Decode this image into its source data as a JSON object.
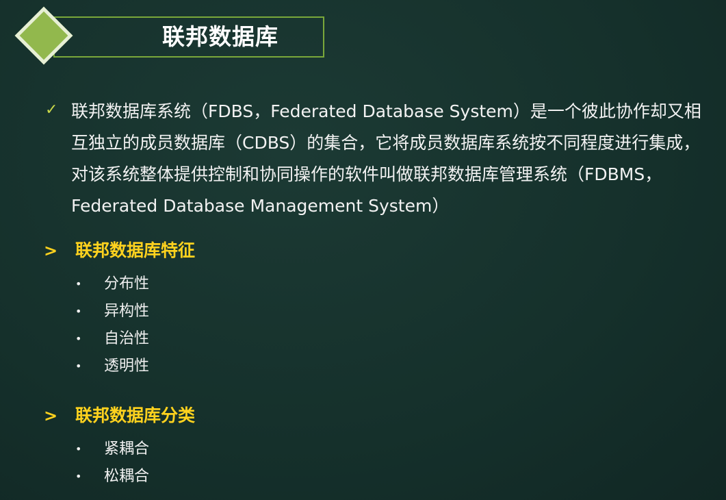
{
  "title": "联邦数据库",
  "intro": {
    "text": "联邦数据库系统（FDBS，Federated Database System）是一个彼此协作却又相互独立的成员数据库（CDBS）的集合，它将成员数据库系统按不同程度进行集成，对该系统整体提供控制和协同操作的软件叫做联邦数据库管理系统（FDBMS，Federated Database Management System）",
    "icon": "check-icon"
  },
  "sections": [
    {
      "heading": "联邦数据库特征",
      "icon": "arrow-right-icon",
      "items": [
        "分布性",
        "异构性",
        "自治性",
        "透明性"
      ]
    },
    {
      "heading": "联邦数据库分类",
      "icon": "arrow-right-icon",
      "items": [
        "紧耦合",
        "松耦合"
      ]
    }
  ],
  "colors": {
    "background": "#15302b",
    "accent": "#92b84d",
    "heading": "#ffd21e",
    "text": "#f2f2f2"
  }
}
